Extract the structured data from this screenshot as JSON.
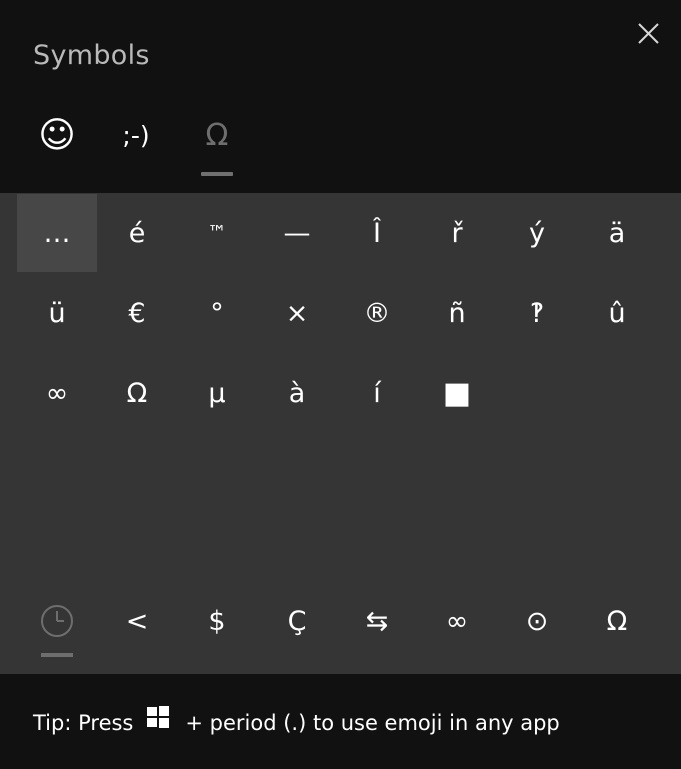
{
  "header": {
    "title": "Symbols"
  },
  "tabs": [
    {
      "label": "☺",
      "name": "emoji"
    },
    {
      "label": ";-)",
      "name": "kaomoji"
    },
    {
      "label": "Ω",
      "name": "symbols"
    }
  ],
  "grid": {
    "rows": [
      [
        "…",
        "é",
        "™",
        "—",
        "Î",
        "ř",
        "ý",
        "ä"
      ],
      [
        "ü",
        "€",
        "°",
        "×",
        "®",
        "ñ",
        "‽",
        "û"
      ],
      [
        "∞",
        "Ω",
        "µ",
        "à",
        "í",
        "■"
      ]
    ]
  },
  "recent": [
    "<",
    "$",
    "Ç",
    "⇆",
    "∞",
    "⊙",
    "Ω"
  ],
  "footer": {
    "tip_prefix": "Tip: Press",
    "tip_suffix": "+ period (.) to use emoji in any app"
  },
  "colors": {
    "panel": "#111111",
    "grid_bg": "#353535",
    "selected": "#474747",
    "accent_gray": "#707070"
  }
}
